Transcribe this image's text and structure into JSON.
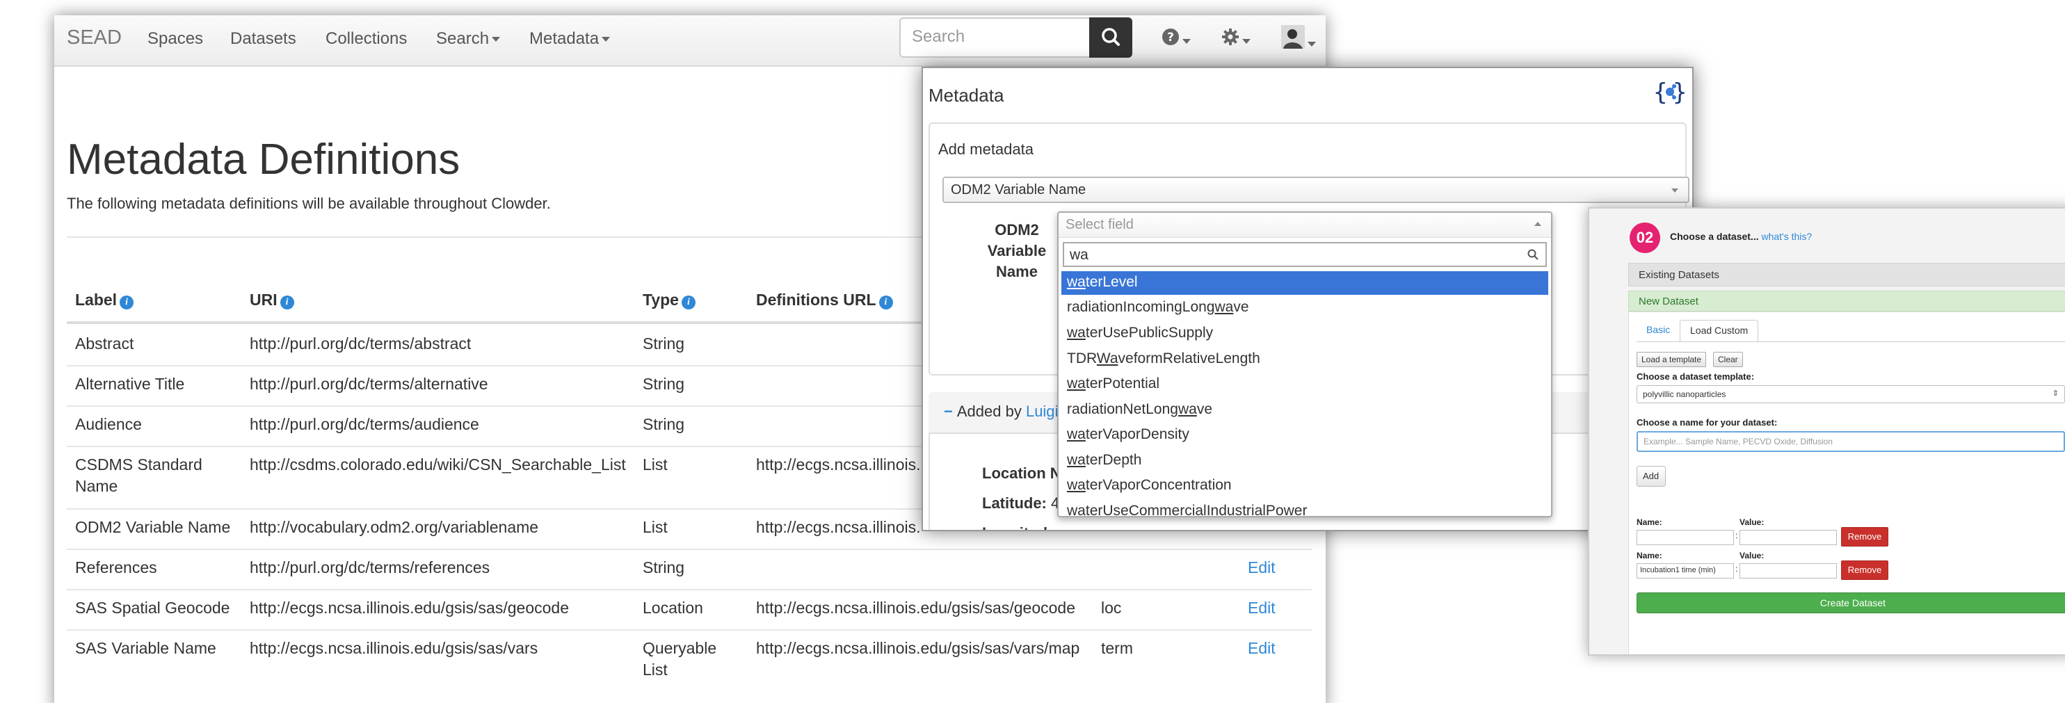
{
  "navbar": {
    "brand": "SEAD",
    "links": [
      "Spaces",
      "Datasets",
      "Collections",
      "Search",
      "Metadata"
    ],
    "search_placeholder": "Search"
  },
  "page": {
    "title": "Metadata Definitions",
    "subtitle": "The following metadata definitions will be available throughout Clowder."
  },
  "table": {
    "headers": [
      "Label",
      "URI",
      "Type",
      "Definitions URL"
    ],
    "rows": [
      {
        "label": "Abstract",
        "uri": "http://purl.org/dc/terms/abstract",
        "type": "String",
        "def_url": "",
        "query": "",
        "edit": ""
      },
      {
        "label": "Alternative Title",
        "uri": "http://purl.org/dc/terms/alternative",
        "type": "String",
        "def_url": "",
        "query": "",
        "edit": ""
      },
      {
        "label": "Audience",
        "uri": "http://purl.org/dc/terms/audience",
        "type": "String",
        "def_url": "",
        "query": "",
        "edit": ""
      },
      {
        "label": "CSDMS Standard Name",
        "uri": "http://csdms.colorado.edu/wiki/CSN_Searchable_List",
        "type": "List",
        "def_url": "http://ecgs.ncsa.illinois.",
        "query": "",
        "edit": ""
      },
      {
        "label": "ODM2 Variable Name",
        "uri": "http://vocabulary.odm2.org/variablename",
        "type": "List",
        "def_url": "http://ecgs.ncsa.illinois.",
        "query": "",
        "edit": ""
      },
      {
        "label": "References",
        "uri": "http://purl.org/dc/terms/references",
        "type": "String",
        "def_url": "",
        "query": "",
        "edit": "Edit"
      },
      {
        "label": "SAS Spatial Geocode",
        "uri": "http://ecgs.ncsa.illinois.edu/gsis/sas/geocode",
        "type": "Location",
        "def_url": "http://ecgs.ncsa.illinois.edu/gsis/sas/geocode",
        "query": "loc",
        "edit": "Edit"
      },
      {
        "label": "SAS Variable Name",
        "uri": "http://ecgs.ncsa.illinois.edu/gsis/sas/vars",
        "type": "Queryable List",
        "def_url": "http://ecgs.ncsa.illinois.edu/gsis/sas/vars/map",
        "query": "term",
        "edit": "Edit"
      }
    ]
  },
  "metadata_modal": {
    "title": "Metadata",
    "add_label": "Add metadata",
    "selected_definition": "ODM2 Variable Name",
    "field_label": "ODM2 Variable Name",
    "added_by_prefix": "Added by",
    "added_by_user": "Luigi",
    "location_label": "Location N",
    "latitude_label": "Latitude:",
    "latitude_value": "4",
    "longitude_label": "Longitude:"
  },
  "dropdown": {
    "placeholder": "Select field",
    "query": "wa",
    "items": [
      {
        "pre": "",
        "match": "wa",
        "post": "terLevel"
      },
      {
        "pre": "radiationIncomingLong",
        "match": "wa",
        "post": "ve"
      },
      {
        "pre": "",
        "match": "wa",
        "post": "terUsePublicSupply"
      },
      {
        "pre": "TDR",
        "match": "Wa",
        "post": "veformRelativeLength"
      },
      {
        "pre": "",
        "match": "wa",
        "post": "terPotential"
      },
      {
        "pre": "radiationNetLong",
        "match": "wa",
        "post": "ve"
      },
      {
        "pre": "",
        "match": "wa",
        "post": "terVaporDensity"
      },
      {
        "pre": "",
        "match": "wa",
        "post": "terDepth"
      },
      {
        "pre": "",
        "match": "wa",
        "post": "terVaporConcentration"
      },
      {
        "pre": "",
        "match": "wa",
        "post": "terUseCommercialIndustrialPower"
      }
    ]
  },
  "dataset_panel": {
    "step": "02",
    "step_text": "Choose a dataset...",
    "step_link": "what's this?",
    "existing": "Existing Datasets",
    "new": "New Dataset",
    "tabs": [
      "Basic",
      "Load Custom"
    ],
    "load_template": "Load a template",
    "clear": "Clear",
    "template_label": "Choose a dataset template:",
    "template_value": "polyvillic nanoparticles",
    "name_label": "Choose a name for your dataset:",
    "name_placeholder": "Example... Sample Name, PECVD Oxide, Diffusion",
    "add": "Add",
    "name_key": "Name:",
    "value_key": "Value:",
    "row2_name": "Incubation1 time (min)",
    "remove": "Remove",
    "create": "Create Dataset"
  },
  "colors": {
    "link": "#2e88d6",
    "highlight": "#3875d7",
    "step_badge": "#e5226f",
    "create_green": "#4cae4c",
    "remove_red": "#c9302c"
  }
}
